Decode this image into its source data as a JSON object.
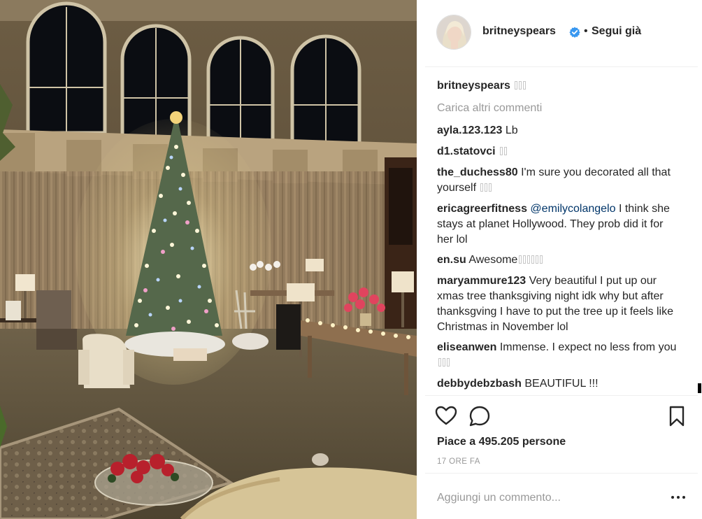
{
  "post": {
    "username": "britneyspears",
    "follow_label": "Segui già",
    "separator": "•"
  },
  "caption": {
    "username": "britneyspears"
  },
  "load_more_label": "Carica altri commenti",
  "comments": [
    {
      "user": "ayla.123.123",
      "text": "Lb"
    },
    {
      "user": "d1.statovci",
      "text": ""
    },
    {
      "user": "the_duchess80",
      "text": "I'm sure you decorated all that yourself"
    },
    {
      "user": "ericagreerfitness",
      "mention": "@emilycolangelo",
      "text": "I think she stays at planet Hollywood. They prob did it for her lol"
    },
    {
      "user": "en.su",
      "text": "Awesome"
    },
    {
      "user": "maryammure123",
      "text": "Very beautiful I put up our xmas tree thanksgiving night idk why but after thanksgving I have to put the tree up it feels like Christmas in November lol"
    },
    {
      "user": "eliseanwen",
      "text": "Immense. I expect no less from you"
    },
    {
      "user": "debbydebzbash",
      "text": "BEAUTIFUL !!!"
    }
  ],
  "likes_label": "Piace a 495.205 persone",
  "time_label": "17 ORE FA",
  "add_comment_placeholder": "Aggiungi un commento...",
  "icons": {
    "like": "heart-icon",
    "comment": "comment-icon",
    "save": "bookmark-icon",
    "verified": "verified-badge-icon",
    "options": "more-options-icon"
  },
  "colors": {
    "verified_blue": "#3897f0",
    "username_text": "#262626",
    "muted_text": "#999999",
    "mention_blue": "#003569"
  }
}
